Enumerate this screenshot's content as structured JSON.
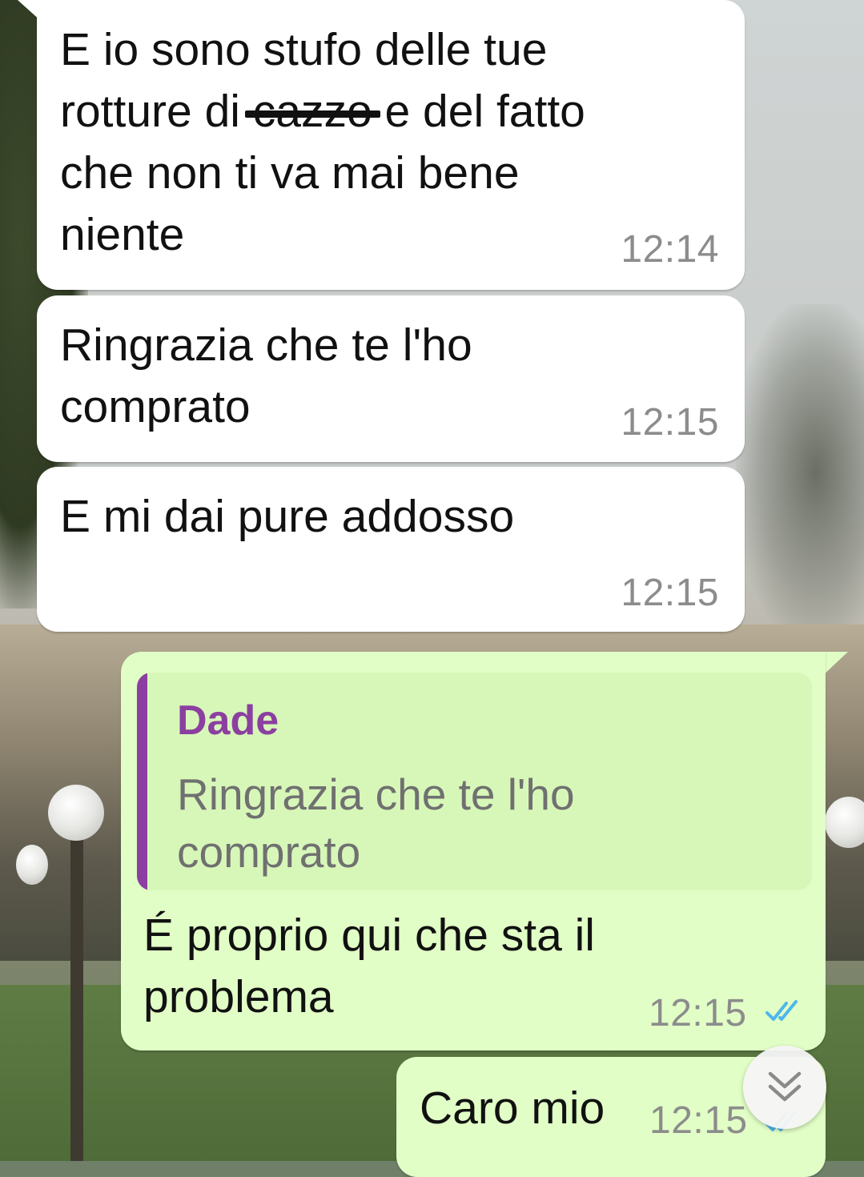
{
  "messages": [
    {
      "direction": "incoming",
      "text_part1": "E io sono stufo delle tue\nrotture di ",
      "redacted_word": "cazzo",
      "text_part2": " e del fatto\nche non ti va mai bene\nniente",
      "time": "12:14"
    },
    {
      "direction": "incoming",
      "text": "Ringrazia che te l'ho\ncomprato",
      "time": "12:15"
    },
    {
      "direction": "incoming",
      "text": "E mi dai pure addosso",
      "time": "12:15"
    },
    {
      "direction": "outgoing",
      "quote": {
        "author": "Dade",
        "text": "Ringrazia che te l'ho\ncomprato"
      },
      "text": "É proprio qui che sta il\nproblema",
      "time": "12:15",
      "status": "read"
    },
    {
      "direction": "outgoing",
      "text": "Caro mio",
      "time": "12:15",
      "status": "read"
    }
  ],
  "colors": {
    "incoming_bubble": "#ffffff",
    "outgoing_bubble": "#e1fec6",
    "quote_accent": "#8b3fa0",
    "read_ticks": "#4fb6ec",
    "timestamp": "#8c8c8c"
  },
  "icons": {
    "read_receipt": "double-check-icon",
    "scroll_down": "chevron-double-down-icon"
  }
}
